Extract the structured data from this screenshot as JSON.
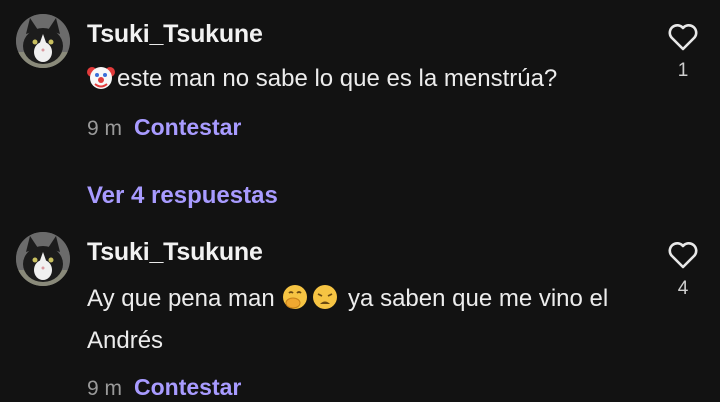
{
  "comments": [
    {
      "username": "Tsuki_Tsukune",
      "emojis": [
        "clown-face-emoji"
      ],
      "text": "este man no sabe lo que es la menstrúa?",
      "time": "9 m",
      "reply_label": "Contestar",
      "likes": "1"
    },
    {
      "username": "Tsuki_Tsukune",
      "text_before": "Ay que pena man",
      "emojis": [
        "face-with-hand-over-mouth-emoji",
        "weary-face-emoji"
      ],
      "text_after": "ya saben que me vino el Andrés",
      "time": "9 m",
      "reply_label": "Contestar",
      "likes": "4"
    }
  ],
  "view_replies_label": "Ver 4 respuestas",
  "colors": {
    "background": "#121212",
    "accent": "#a89bff",
    "text": "#ececec",
    "muted": "#9a9a9a"
  }
}
